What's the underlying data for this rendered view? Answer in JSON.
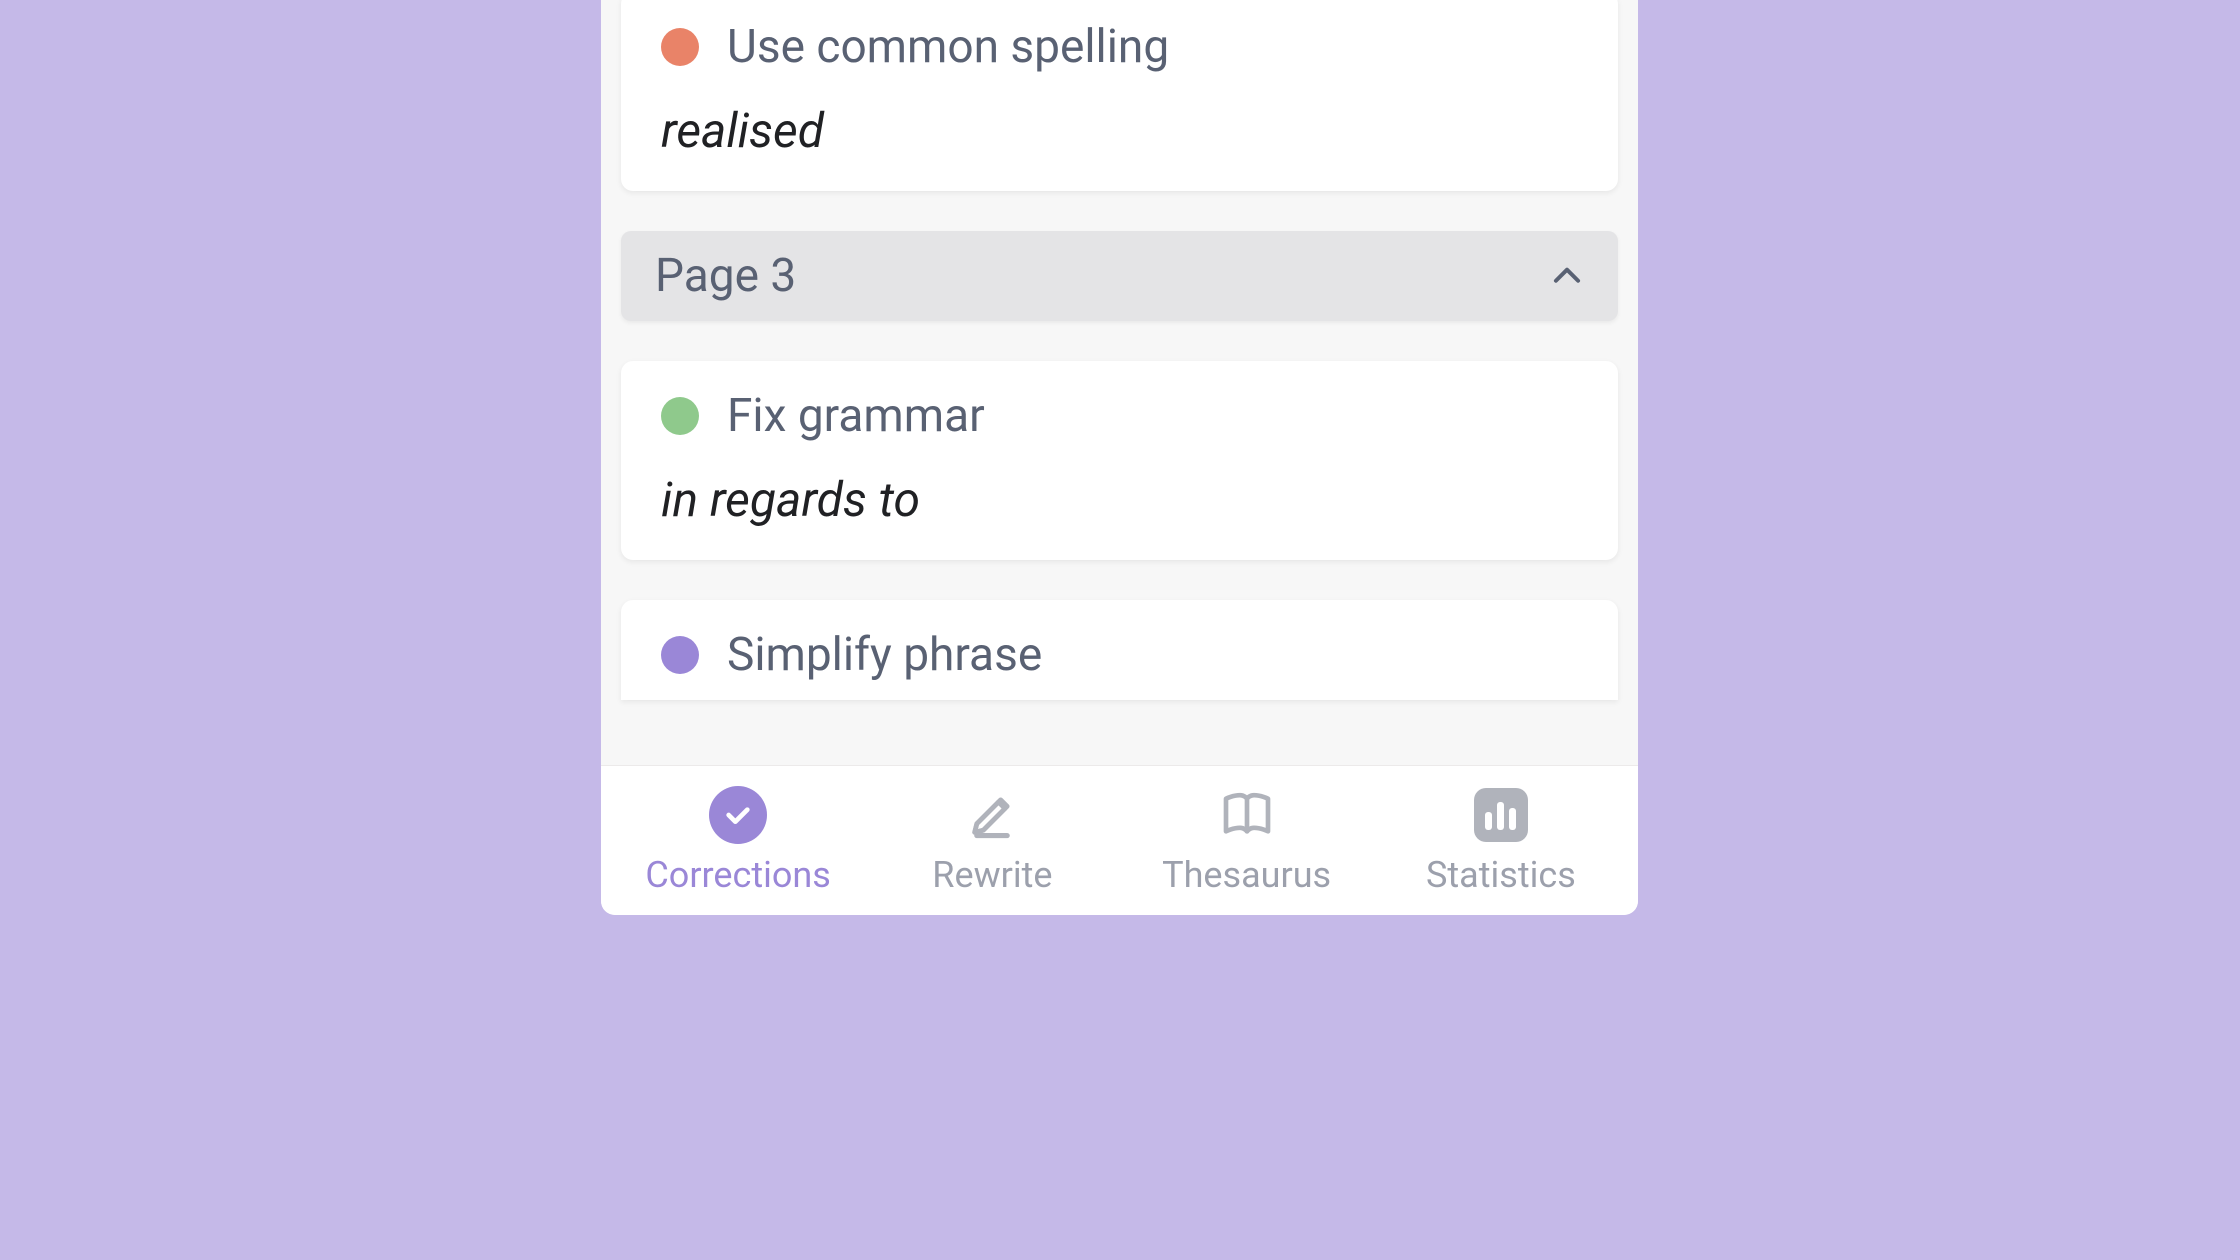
{
  "cards": [
    {
      "dot_color": "orange",
      "title": "Use common spelling",
      "snippet": "realised"
    }
  ],
  "page_header": {
    "label": "Page 3"
  },
  "page3_cards": [
    {
      "dot_color": "green",
      "title": "Fix grammar",
      "snippet": "in regards to"
    },
    {
      "dot_color": "purple",
      "title": "Simplify phrase"
    }
  ],
  "nav": {
    "corrections": "Corrections",
    "rewrite": "Rewrite",
    "thesaurus": "Thesaurus",
    "statistics": "Statistics"
  },
  "colors": {
    "orange": "#e98368",
    "green": "#8fc98c",
    "purple": "#9a87d7",
    "nav_inactive": "#9ca0ac",
    "text_muted": "#596173"
  }
}
